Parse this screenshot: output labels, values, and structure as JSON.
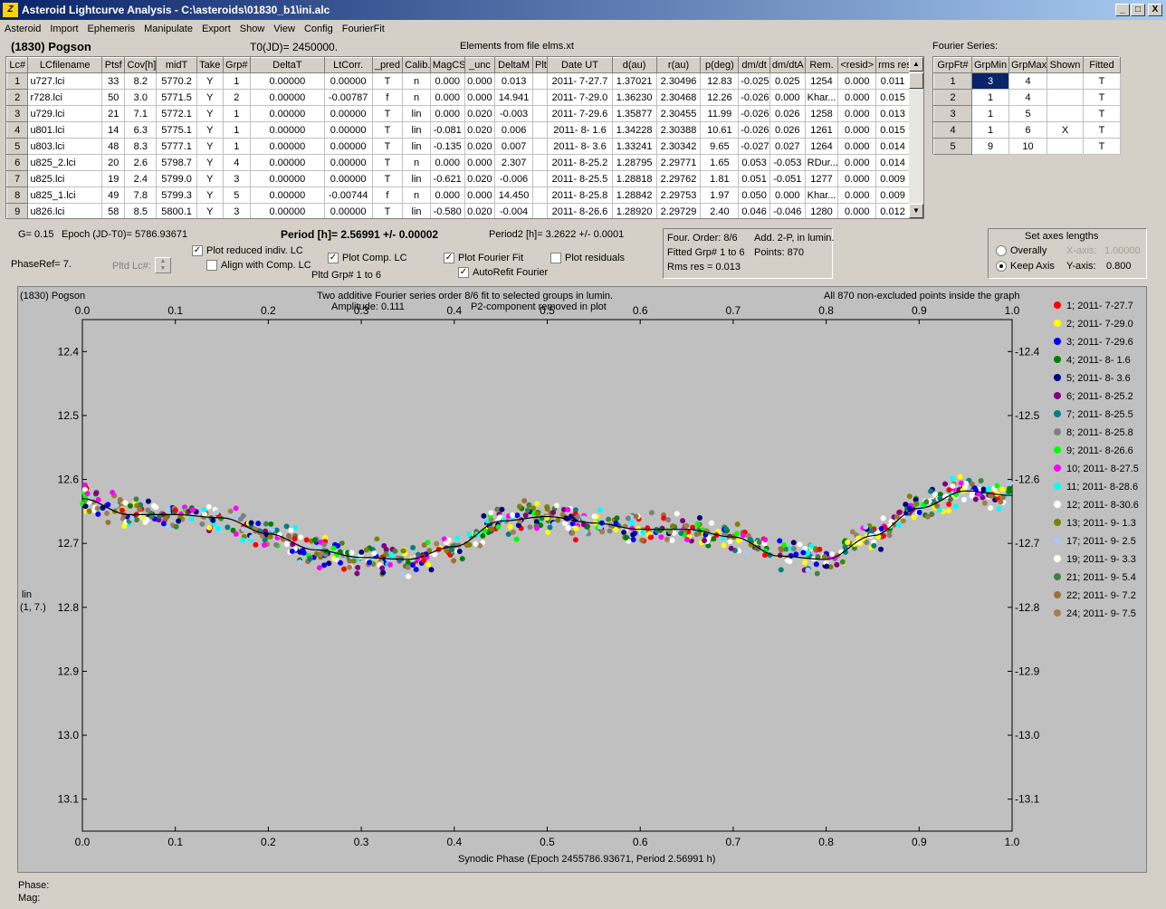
{
  "window": {
    "title": "Asteroid Lightcurve Analysis - C:\\asteroids\\01830_b1\\ini.alc",
    "icon_text": "Z",
    "minimize": "_",
    "maximize": "□",
    "close": "X"
  },
  "menu": [
    "Asteroid",
    "Import",
    "Ephemeris",
    "Manipulate",
    "Export",
    "Show",
    "View",
    "Config",
    "FourierFit"
  ],
  "header": {
    "asteroid": "(1830) Pogson",
    "t0": "T0(JD)= 2450000.",
    "elements": "Elements from file elms.xt"
  },
  "lc_table": {
    "columns": [
      "Lc#",
      "LCfilename",
      "Ptsf",
      "Cov[h]",
      "midT",
      "Take",
      "Grp#",
      "DeltaT",
      "LtCorr.",
      "_pred",
      "Calib.",
      "MagCS",
      "_unc",
      "DeltaM",
      "Plt",
      "Date UT",
      "d(au)",
      "r(au)",
      "p(deg)",
      "dm/dt",
      "dm/dtA",
      "Rem.",
      "<resid>",
      "rms res"
    ],
    "rows": [
      [
        "1",
        "u727.lci",
        "33",
        "8.2",
        "5770.2",
        "Y",
        "1",
        "0.00000",
        "0.00000",
        "T",
        "n",
        "0.000",
        "0.000",
        "0.013",
        "",
        "2011- 7-27.7",
        "1.37021",
        "2.30496",
        "12.83",
        "-0.025",
        "0.025",
        "1254",
        "0.000",
        "0.011"
      ],
      [
        "2",
        "r728.lci",
        "50",
        "3.0",
        "5771.5",
        "Y",
        "2",
        "0.00000",
        "-0.00787",
        "f",
        "n",
        "0.000",
        "0.000",
        "14.941",
        "",
        "2011- 7-29.0",
        "1.36230",
        "2.30468",
        "12.26",
        "-0.026",
        "0.000",
        "Khar...",
        "0.000",
        "0.015"
      ],
      [
        "3",
        "u729.lci",
        "21",
        "7.1",
        "5772.1",
        "Y",
        "1",
        "0.00000",
        "0.00000",
        "T",
        "lin",
        "0.000",
        "0.020",
        "-0.003",
        "",
        "2011- 7-29.6",
        "1.35877",
        "2.30455",
        "11.99",
        "-0.026",
        "0.026",
        "1258",
        "0.000",
        "0.013"
      ],
      [
        "4",
        "u801.lci",
        "14",
        "6.3",
        "5775.1",
        "Y",
        "1",
        "0.00000",
        "0.00000",
        "T",
        "lin",
        "-0.081",
        "0.020",
        "0.006",
        "",
        "2011- 8- 1.6",
        "1.34228",
        "2.30388",
        "10.61",
        "-0.026",
        "0.026",
        "1261",
        "0.000",
        "0.015"
      ],
      [
        "5",
        "u803.lci",
        "48",
        "8.3",
        "5777.1",
        "Y",
        "1",
        "0.00000",
        "0.00000",
        "T",
        "lin",
        "-0.135",
        "0.020",
        "0.007",
        "",
        "2011- 8- 3.6",
        "1.33241",
        "2.30342",
        "9.65",
        "-0.027",
        "0.027",
        "1264",
        "0.000",
        "0.014"
      ],
      [
        "6",
        "u825_2.lci",
        "20",
        "2.6",
        "5798.7",
        "Y",
        "4",
        "0.00000",
        "0.00000",
        "T",
        "n",
        "0.000",
        "0.000",
        "2.307",
        "",
        "2011- 8-25.2",
        "1.28795",
        "2.29771",
        "1.65",
        "0.053",
        "-0.053",
        "RDur...",
        "0.000",
        "0.014"
      ],
      [
        "7",
        "u825.lci",
        "19",
        "2.4",
        "5799.0",
        "Y",
        "3",
        "0.00000",
        "0.00000",
        "T",
        "lin",
        "-0.621",
        "0.020",
        "-0.006",
        "",
        "2011- 8-25.5",
        "1.28818",
        "2.29762",
        "1.81",
        "0.051",
        "-0.051",
        "1277",
        "0.000",
        "0.009"
      ],
      [
        "8",
        "u825_1.lci",
        "49",
        "7.8",
        "5799.3",
        "Y",
        "5",
        "0.00000",
        "-0.00744",
        "f",
        "n",
        "0.000",
        "0.000",
        "14.450",
        "",
        "2011- 8-25.8",
        "1.28842",
        "2.29753",
        "1.97",
        "0.050",
        "0.000",
        "Khar...",
        "0.000",
        "0.009"
      ],
      [
        "9",
        "u826.lci",
        "58",
        "8.5",
        "5800.1",
        "Y",
        "3",
        "0.00000",
        "0.00000",
        "T",
        "lin",
        "-0.580",
        "0.020",
        "-0.004",
        "",
        "2011- 8-26.6",
        "1.28920",
        "2.29729",
        "2.40",
        "0.046",
        "-0.046",
        "1280",
        "0.000",
        "0.012"
      ]
    ]
  },
  "fourier_table": {
    "title": "Fourier Series:",
    "columns": [
      "GrpFt#",
      "GrpMin",
      "GrpMax",
      "Shown",
      "Fitted"
    ],
    "rows": [
      [
        "1",
        "3",
        "4",
        "",
        "T"
      ],
      [
        "2",
        "1",
        "4",
        "",
        "T"
      ],
      [
        "3",
        "1",
        "5",
        "",
        "T"
      ],
      [
        "4",
        "1",
        "6",
        "X",
        "T"
      ],
      [
        "5",
        "9",
        "10",
        "",
        "T"
      ]
    ]
  },
  "controls": {
    "g_value": "G= 0.15",
    "epoch": "Epoch (JD-T0)= 5786.93671",
    "period": "Period [h]= 2.56991 +/- 0.00002",
    "period2": "Period2 [h]= 3.2622 +/- 0.0001",
    "phaseref": "PhaseRef= 7.",
    "pltd_lc": "Pltd Lc#:",
    "cb_reduced": "Plot reduced indiv. LC",
    "cb_align": "Align with Comp. LC",
    "cb_comp": "Plot Comp. LC",
    "cb_fourier": "Plot Fourier Fit",
    "cb_autorefit": "AutoRefit Fourier",
    "cb_residuals": "Plot residuals",
    "pltd_grp": "Pltd Grp#  1   to   6",
    "info1": "Four. Order:  8/6",
    "info2": "Add. 2-P, in lumin.",
    "info3": "Fitted Grp# 1 to 6",
    "info4": "Points: 870",
    "info5": "Rms res     = 0.013",
    "axes_title": "Set axes lengths",
    "overall": "Overally",
    "keep": "Keep Axis",
    "xaxis_lbl": "X-axis:",
    "xaxis_val": "1.00000",
    "yaxis_lbl": "Y-axis:",
    "yaxis_val": "0.800"
  },
  "plot": {
    "name": "(1830) Pogson",
    "line1": "Two additive Fourier series order 8/6 fit to selected groups in lumin.",
    "line2": "Amplitude: 0.111",
    "line3": "P2-component removed in plot",
    "right": "All 870 non-excluded points inside the graph",
    "ylab1": "lin",
    "ylab2": "(1, 7.)",
    "xlabel": "Synodic Phase (Epoch 2455786.93671, Period 2.56991 h)"
  },
  "chart_data": {
    "type": "scatter",
    "xlim": [
      0,
      1.0
    ],
    "ylim": [
      13.15,
      12.35
    ],
    "x_ticks": [
      "0.0",
      "0.1",
      "0.2",
      "0.3",
      "0.4",
      "0.5",
      "0.6",
      "0.7",
      "0.8",
      "0.9",
      "1.0"
    ],
    "y_ticks": [
      "12.4",
      "12.5",
      "12.6",
      "12.7",
      "12.8",
      "12.9",
      "13.0",
      "13.1"
    ],
    "fit_curve": {
      "x": [
        0,
        0.05,
        0.1,
        0.15,
        0.2,
        0.25,
        0.3,
        0.35,
        0.4,
        0.45,
        0.5,
        0.55,
        0.6,
        0.65,
        0.7,
        0.75,
        0.8,
        0.85,
        0.9,
        0.95,
        1.0
      ],
      "y": [
        12.63,
        12.655,
        12.655,
        12.66,
        12.685,
        12.71,
        12.722,
        12.725,
        12.705,
        12.665,
        12.658,
        12.668,
        12.678,
        12.678,
        12.69,
        12.72,
        12.725,
        12.688,
        12.645,
        12.618,
        12.625
      ]
    },
    "series": [
      {
        "name": "1; 2011- 7-27.7",
        "color": "#ff0000"
      },
      {
        "name": "2; 2011- 7-29.0",
        "color": "#ffff00"
      },
      {
        "name": "3; 2011- 7-29.6",
        "color": "#0000ff"
      },
      {
        "name": "4; 2011- 8- 1.6",
        "color": "#008000"
      },
      {
        "name": "5; 2011- 8- 3.6",
        "color": "#000080"
      },
      {
        "name": "6; 2011- 8-25.2",
        "color": "#800080"
      },
      {
        "name": "7; 2011- 8-25.5",
        "color": "#008080"
      },
      {
        "name": "8; 2011- 8-25.8",
        "color": "#808080"
      },
      {
        "name": "9; 2011- 8-26.6",
        "color": "#00ff00"
      },
      {
        "name": "10; 2011- 8-27.5",
        "color": "#ff00ff"
      },
      {
        "name": "11; 2011- 8-28.6",
        "color": "#00ffff"
      },
      {
        "name": "12; 2011- 8-30.6",
        "color": "#ffffff"
      },
      {
        "name": "13; 2011- 9- 1.3",
        "color": "#808000"
      },
      {
        "name": "17; 2011- 9- 2.5",
        "color": "#a6caf0"
      },
      {
        "name": "19; 2011- 9- 3.3",
        "color": "#fffbf0"
      },
      {
        "name": "21; 2011- 9- 5.4",
        "color": "#408040"
      },
      {
        "name": "22; 2011- 9- 7.2",
        "color": "#a0703a"
      },
      {
        "name": "24; 2011- 9- 7.5",
        "color": "#a08050"
      }
    ]
  },
  "status": {
    "phase": "Phase:",
    "mag": "Mag:"
  }
}
